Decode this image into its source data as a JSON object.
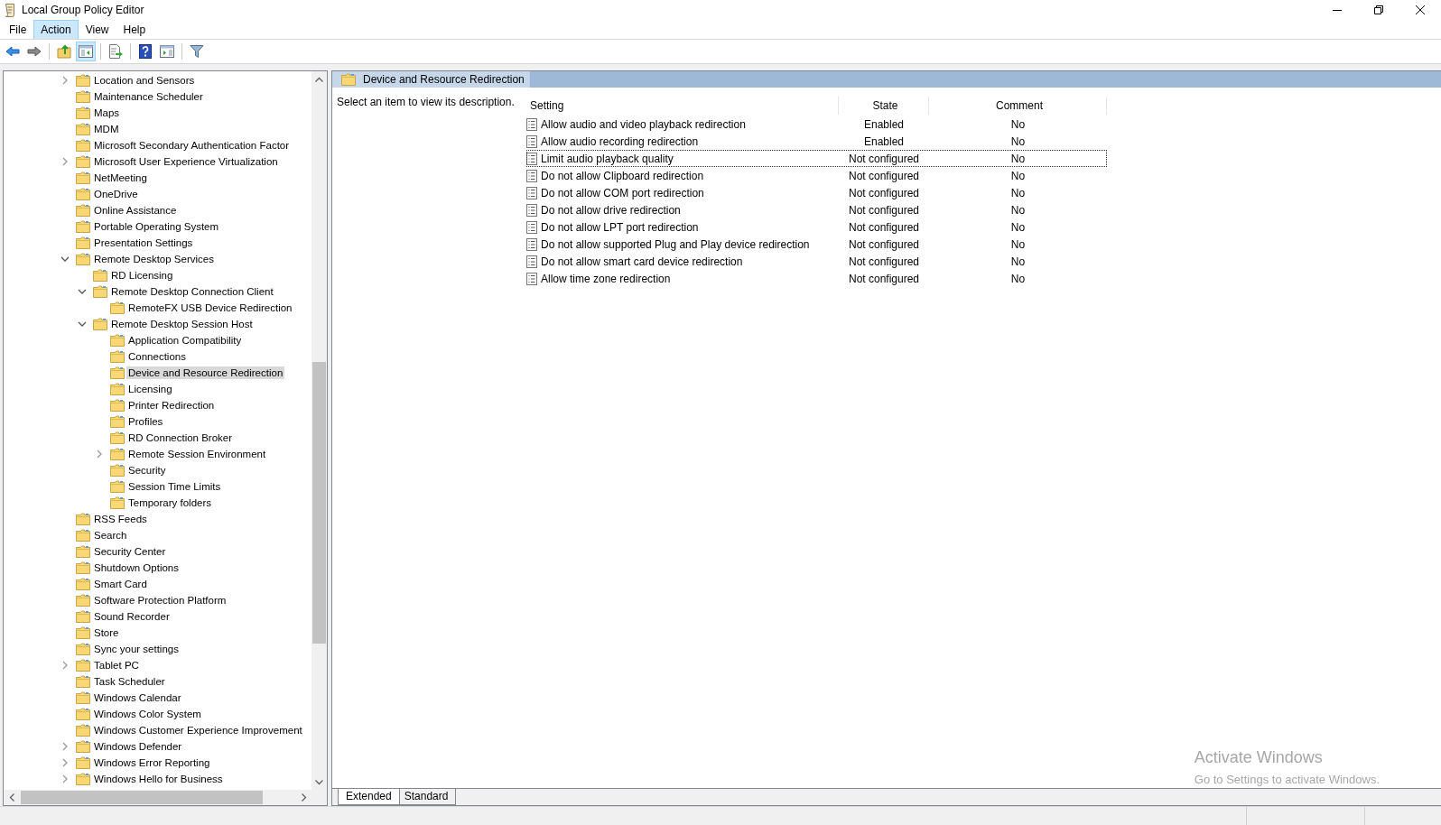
{
  "window": {
    "title": "Local Group Policy Editor"
  },
  "menu": [
    {
      "label": "File",
      "highlighted": false
    },
    {
      "label": "Action",
      "highlighted": true
    },
    {
      "label": "View",
      "highlighted": false
    },
    {
      "label": "Help",
      "highlighted": false
    }
  ],
  "toolbar": [
    {
      "kind": "back",
      "pressed": false
    },
    {
      "kind": "forward",
      "pressed": false
    },
    {
      "kind": "sep"
    },
    {
      "kind": "up",
      "pressed": false
    },
    {
      "kind": "tree",
      "pressed": true
    },
    {
      "kind": "sep"
    },
    {
      "kind": "export",
      "pressed": false
    },
    {
      "kind": "sep"
    },
    {
      "kind": "help",
      "pressed": false
    },
    {
      "kind": "pane",
      "pressed": false
    },
    {
      "kind": "sep"
    },
    {
      "kind": "filter",
      "pressed": false
    }
  ],
  "tree": [
    {
      "label": "Location and Sensors",
      "expanded": false,
      "selected": false
    },
    {
      "label": "Maintenance Scheduler",
      "selected": false
    },
    {
      "label": "Maps",
      "selected": false
    },
    {
      "label": "MDM",
      "selected": false
    },
    {
      "label": "Microsoft Secondary Authentication Factor",
      "selected": false
    },
    {
      "label": "Microsoft User Experience Virtualization",
      "expanded": false,
      "selected": false
    },
    {
      "label": "NetMeeting",
      "selected": false
    },
    {
      "label": "OneDrive",
      "selected": false
    },
    {
      "label": "Online Assistance",
      "selected": false
    },
    {
      "label": "Portable Operating System",
      "selected": false
    },
    {
      "label": "Presentation Settings",
      "selected": false
    },
    {
      "label": "Remote Desktop Services",
      "expanded": true,
      "selected": false,
      "children": [
        {
          "label": "RD Licensing",
          "selected": false
        },
        {
          "label": "Remote Desktop Connection Client",
          "expanded": true,
          "selected": false,
          "children": [
            {
              "label": "RemoteFX USB Device Redirection",
              "selected": false
            }
          ]
        },
        {
          "label": "Remote Desktop Session Host",
          "expanded": true,
          "selected": false,
          "children": [
            {
              "label": "Application Compatibility",
              "selected": false
            },
            {
              "label": "Connections",
              "selected": false
            },
            {
              "label": "Device and Resource Redirection",
              "selected": true
            },
            {
              "label": "Licensing",
              "selected": false
            },
            {
              "label": "Printer Redirection",
              "selected": false
            },
            {
              "label": "Profiles",
              "selected": false
            },
            {
              "label": "RD Connection Broker",
              "selected": false
            },
            {
              "label": "Remote Session Environment",
              "expanded": false,
              "selected": false
            },
            {
              "label": "Security",
              "selected": false
            },
            {
              "label": "Session Time Limits",
              "selected": false
            },
            {
              "label": "Temporary folders",
              "selected": false
            }
          ]
        }
      ]
    },
    {
      "label": "RSS Feeds",
      "selected": false
    },
    {
      "label": "Search",
      "selected": false
    },
    {
      "label": "Security Center",
      "selected": false
    },
    {
      "label": "Shutdown Options",
      "selected": false
    },
    {
      "label": "Smart Card",
      "selected": false
    },
    {
      "label": "Software Protection Platform",
      "selected": false
    },
    {
      "label": "Sound Recorder",
      "selected": false
    },
    {
      "label": "Store",
      "selected": false
    },
    {
      "label": "Sync your settings",
      "selected": false
    },
    {
      "label": "Tablet PC",
      "expanded": false,
      "selected": false
    },
    {
      "label": "Task Scheduler",
      "selected": false
    },
    {
      "label": "Windows Calendar",
      "selected": false
    },
    {
      "label": "Windows Color System",
      "selected": false
    },
    {
      "label": "Windows Customer Experience Improvement",
      "selected": false
    },
    {
      "label": "Windows Defender",
      "expanded": false,
      "selected": false
    },
    {
      "label": "Windows Error Reporting",
      "expanded": false,
      "selected": false
    },
    {
      "label": "Windows Hello for Business",
      "expanded": false,
      "selected": false
    }
  ],
  "details": {
    "header": "Device and Resource Redirection",
    "description": "Select an item to view its description.",
    "columns": [
      "Setting",
      "State",
      "Comment"
    ],
    "rows": [
      {
        "setting": "Allow audio and video playback redirection",
        "state": "Enabled",
        "comment": "No",
        "focused": false
      },
      {
        "setting": "Allow audio recording redirection",
        "state": "Enabled",
        "comment": "No",
        "focused": false
      },
      {
        "setting": "Limit audio playback quality",
        "state": "Not configured",
        "comment": "No",
        "focused": true
      },
      {
        "setting": "Do not allow Clipboard redirection",
        "state": "Not configured",
        "comment": "No",
        "focused": false
      },
      {
        "setting": "Do not allow COM port redirection",
        "state": "Not configured",
        "comment": "No",
        "focused": false
      },
      {
        "setting": "Do not allow drive redirection",
        "state": "Not configured",
        "comment": "No",
        "focused": false
      },
      {
        "setting": "Do not allow LPT port redirection",
        "state": "Not configured",
        "comment": "No",
        "focused": false
      },
      {
        "setting": "Do not allow supported Plug and Play device redirection",
        "state": "Not configured",
        "comment": "No",
        "focused": false
      },
      {
        "setting": "Do not allow smart card device redirection",
        "state": "Not configured",
        "comment": "No",
        "focused": false
      },
      {
        "setting": "Allow time zone redirection",
        "state": "Not configured",
        "comment": "No",
        "focused": false
      }
    ],
    "tabs": [
      {
        "label": "Extended",
        "selected": true
      },
      {
        "label": "Standard",
        "selected": false
      }
    ]
  },
  "activation": {
    "title": "Activate Windows",
    "subtitle": "Go to Settings to activate Windows."
  }
}
